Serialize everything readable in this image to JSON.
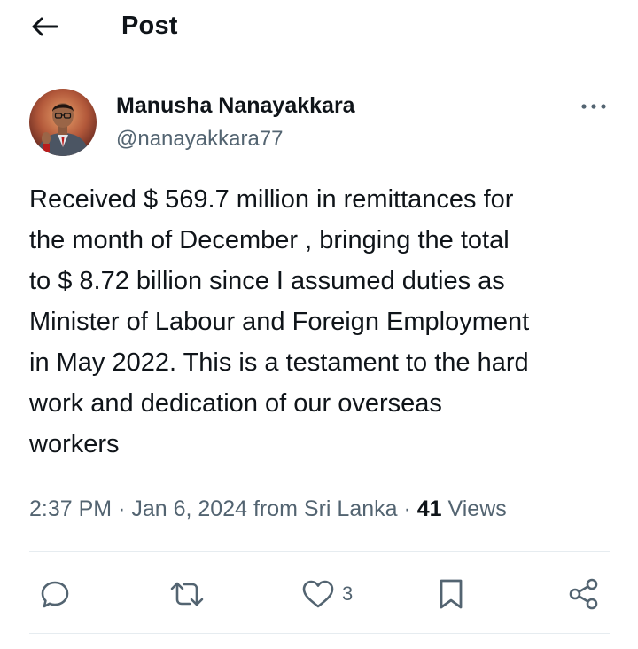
{
  "header": {
    "title": "Post",
    "back_icon": "arrow-left-icon"
  },
  "author": {
    "name": "Manusha Nanayakkara",
    "handle": "@nanayakkara77",
    "more_icon": "more-horizontal-icon"
  },
  "post": {
    "text": "Received $ 569.7 million in remittances for\nthe month of December , bringing the total\nto $ 8.72 billion since I assumed duties as\nMinister of Labour and Foreign Employment\nin May 2022. This is a testament to the hard\nwork and dedication of our overseas\nworkers"
  },
  "meta": {
    "time": "2:37 PM",
    "separator": "·",
    "date": "Jan 6, 2024",
    "from_location": "from Sri Lanka",
    "views_count": "41",
    "views_label": "Views"
  },
  "actions": {
    "reply": {
      "icon": "reply-icon"
    },
    "repost": {
      "icon": "repost-icon"
    },
    "like": {
      "icon": "heart-icon",
      "count": "3"
    },
    "bookmark": {
      "icon": "bookmark-icon"
    },
    "share": {
      "icon": "share-icon"
    }
  },
  "colors": {
    "text_primary": "#0f1419",
    "text_secondary": "#536471",
    "divider": "#e6ecf0",
    "background": "#ffffff"
  }
}
